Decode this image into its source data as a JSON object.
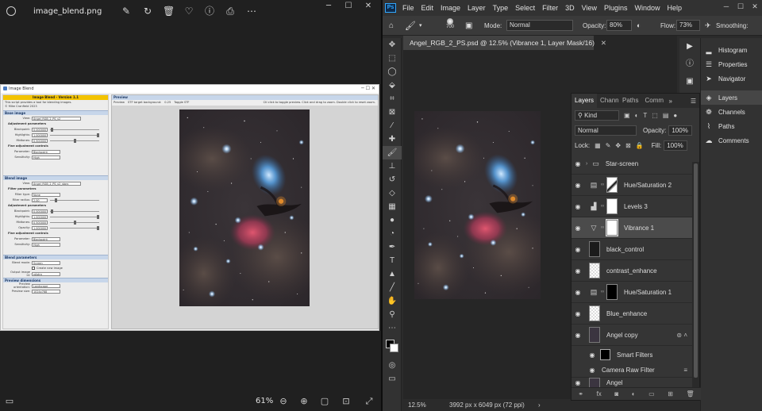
{
  "viewer": {
    "filename": "image_blend.png",
    "zoom": "61%"
  },
  "embedded": {
    "window_title": "Image Blend",
    "header": "Image Blend - Version 1.1",
    "info_lines": [
      "This script provides a tool for blending images.",
      "© Mike Cranfield 2023"
    ],
    "base_section": "Base image",
    "blend_section": "Blend image",
    "view_label": "View:",
    "base_view": "Angel_RGB_2_PS_v2",
    "blend_view": "Angel_RGB_2_PS_v2_stars",
    "adjustment_label": "Adjustment parameters",
    "fine_label": "Fine adjustment controls",
    "filter_label": "Filter parameters",
    "blackpoint_label": "Blackpoint:",
    "highlights_label": "Highlights:",
    "midtones_label": "Midtones:",
    "opacity_label": "Opacity:",
    "parameter_label": "Parameter:",
    "sensitivity_label": "Sensitivity:",
    "filter_type_label": "Filter type:",
    "filter_radius_label": "Filter radius:",
    "base_values": [
      "0.000000",
      "1.000000",
      "0.500000"
    ],
    "blend_values": [
      "0.000000",
      "1.000000",
      "0.500000",
      "1.000000"
    ],
    "parameter_value": "Blackpoint",
    "sensitivity_value": "High",
    "filter_type_value": "None",
    "filter_radius_value": "2.00",
    "blend_params_section": "Blend parameters",
    "blend_mode_label": "Blend mode:",
    "blend_mode_value": "Screen",
    "create_new_label": "Create new image",
    "output_label": "Output image id:",
    "output_value": "xAstro",
    "preview_dims_section": "Preview dimensions",
    "preview_orient_label": "Preview orientation:",
    "preview_orient_value": "Landscape",
    "preview_size_label": "Preview size:",
    "preview_size_value": "1024x768",
    "preview_section": "Preview",
    "preview_check": "Preview",
    "stf_label": "STF target background:",
    "stf_value": "0.25",
    "toggle_stf": "Toggle STF",
    "hint": "Ctl click to toggle preview. Click and drag to zoom. Double click to reset zoom."
  },
  "ps": {
    "logo": "Ps",
    "menus": [
      "File",
      "Edit",
      "Image",
      "Layer",
      "Type",
      "Select",
      "Filter",
      "3D",
      "View",
      "Plugins",
      "Window",
      "Help"
    ],
    "brush_size": "700",
    "mode_label": "Mode:",
    "mode_value": "Normal",
    "opacity_label": "Opacity:",
    "opacity_value": "80%",
    "flow_label": "Flow:",
    "flow_value": "73%",
    "smoothing_label": "Smoothing:",
    "doc_title": "Angel_RGB_2_PS.psd @ 12.5% (Vibrance 1, Layer Mask/16)",
    "status_zoom": "12.5%",
    "status_dims": "3992 px x 6049 px (72 ppi)",
    "right_panels": [
      "Histogram",
      "Properties",
      "Navigator",
      "Layers",
      "Channels",
      "Paths",
      "Comments"
    ],
    "layers_tabs": [
      "Layers",
      "Channels",
      "Paths",
      "Comments"
    ],
    "kind_label": "Kind",
    "blend_mode": "Normal",
    "layer_opacity_label": "Opacity:",
    "layer_opacity": "100%",
    "lock_label": "Lock:",
    "fill_label": "Fill:",
    "fill_value": "100%",
    "layers": [
      {
        "name": "Star-screen",
        "type": "group"
      },
      {
        "name": "Hue/Saturation 2",
        "type": "huesat"
      },
      {
        "name": "Levels 3",
        "type": "levels"
      },
      {
        "name": "Vibrance 1",
        "type": "vibrance"
      },
      {
        "name": "black_control",
        "type": "pixel"
      },
      {
        "name": "contrast_enhance",
        "type": "pixel"
      },
      {
        "name": "Hue/Saturation 1",
        "type": "huesat"
      },
      {
        "name": "Blue_enhance",
        "type": "pixel"
      },
      {
        "name": "Angel copy",
        "type": "smart"
      },
      {
        "name": "Smart Filters",
        "type": "filter"
      },
      {
        "name": "Camera Raw Filter",
        "type": "filteritem"
      },
      {
        "name": "Angel",
        "type": "pixel"
      }
    ]
  }
}
